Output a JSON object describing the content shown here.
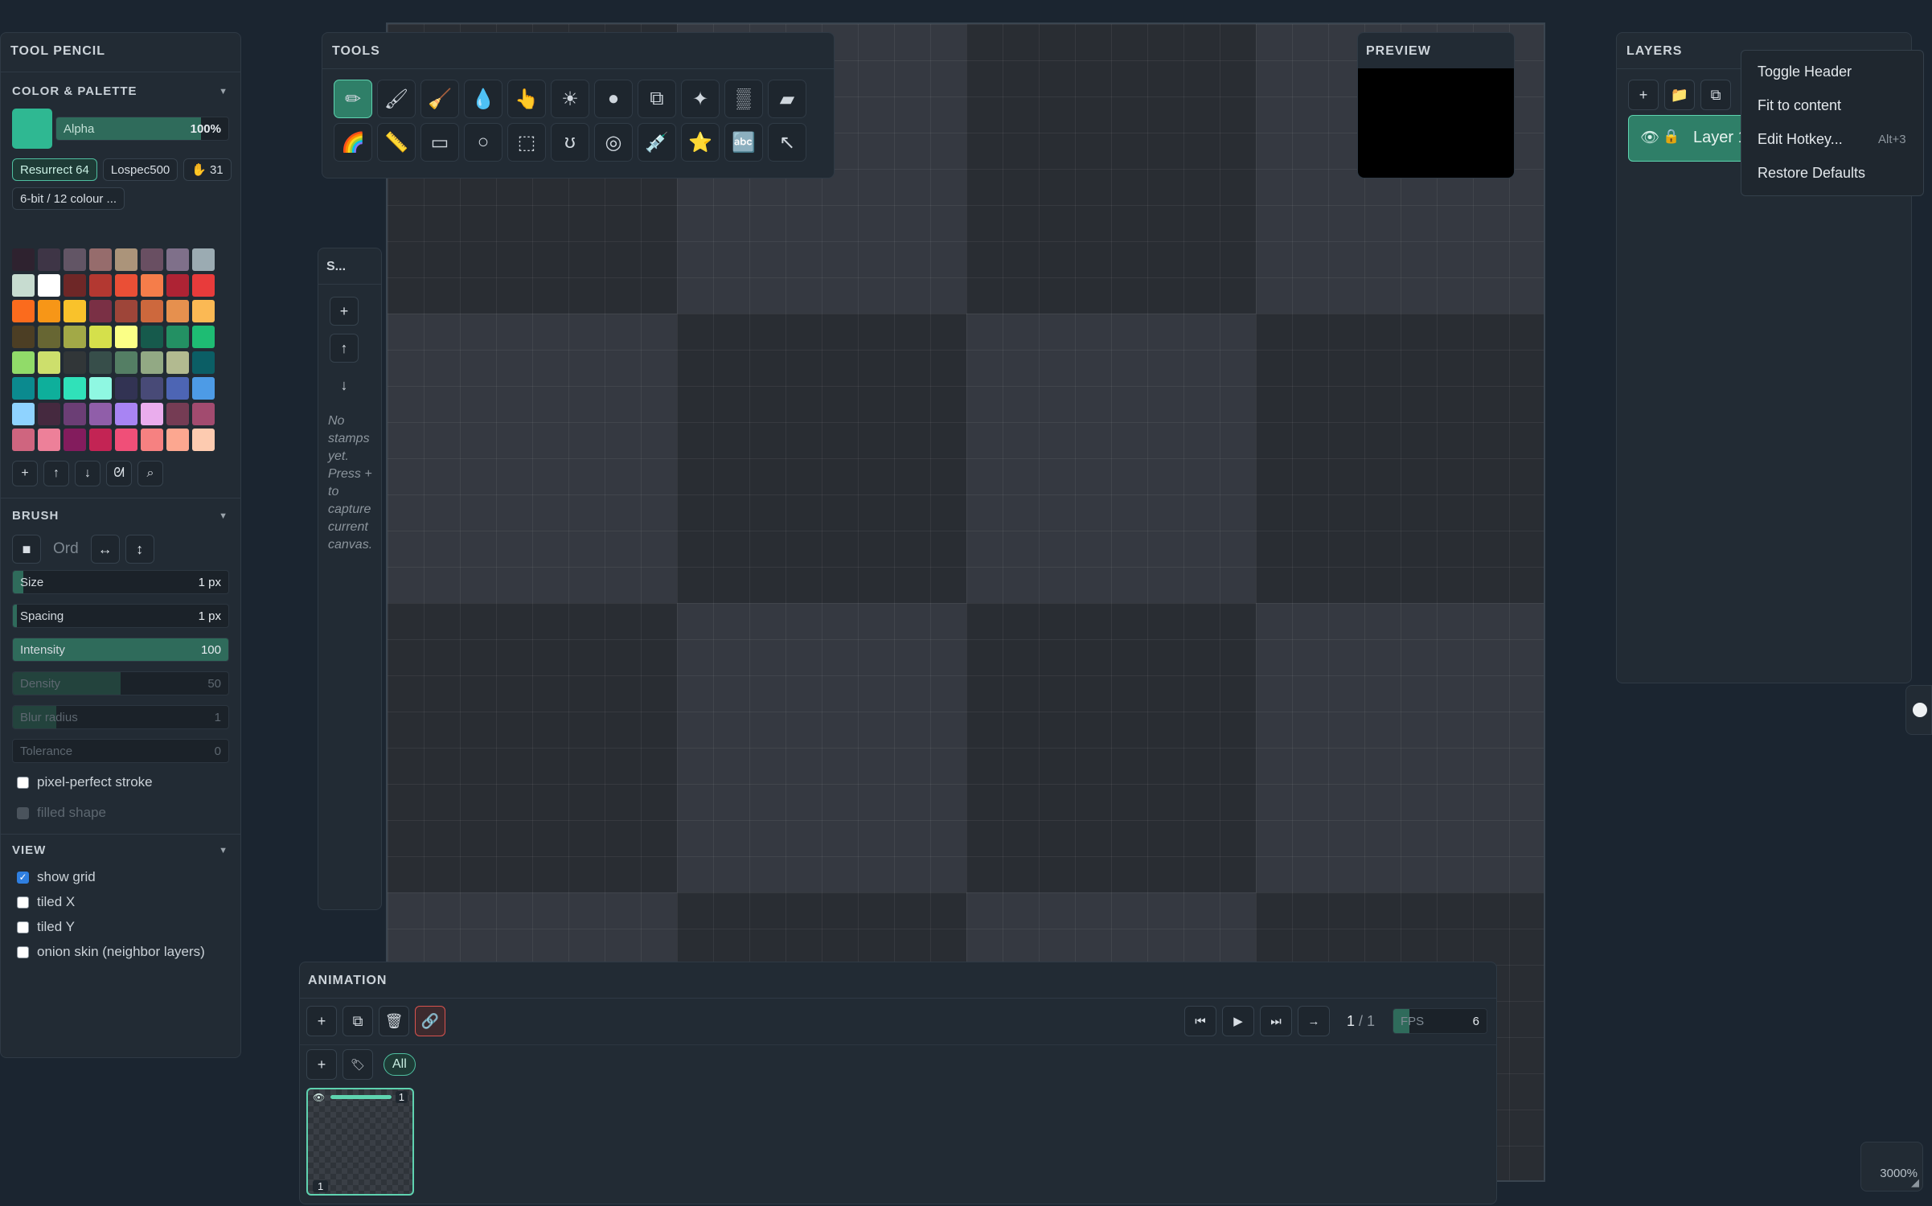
{
  "canvas": {
    "zoom": "3000%"
  },
  "left_panel": {
    "title": "TOOL PENCIL",
    "color_section": {
      "title": "COLOR & PALETTE",
      "current_color": "#2fb892",
      "alpha_label": "Alpha",
      "alpha_value": "100%",
      "alpha_fraction": 0.84,
      "palette_tabs": [
        "Resurrect 64",
        "Lospec500"
      ],
      "palette_count": "31",
      "palette_filter": "6-bit / 12 colour ...",
      "swatches": [
        "#2e222f",
        "#3e3546",
        "#625565",
        "#966c6c",
        "#ab947a",
        "#694f62",
        "#7f708a",
        "#9babb2",
        "#c7dcd0",
        "#ffffff",
        "#6e2727",
        "#b33831",
        "#ea4f36",
        "#f57d4a",
        "#ae2334",
        "#e83b3b",
        "#fb6b1d",
        "#f79617",
        "#f9c22b",
        "#7a3045",
        "#9e4539",
        "#cd683d",
        "#e6904e",
        "#fbb954",
        "#4c3e24",
        "#676633",
        "#a2a947",
        "#d5e04b",
        "#fbff86",
        "#165a4c",
        "#239063",
        "#1ebc73",
        "#91db69",
        "#cddf6c",
        "#313638",
        "#374e4a",
        "#547e64",
        "#92a984",
        "#b2ba90",
        "#0b5e65",
        "#0b8a8f",
        "#0eaf9b",
        "#30e1b9",
        "#8ff8e2",
        "#323353",
        "#484a77",
        "#4d65b4",
        "#4d9be6",
        "#8fd3ff",
        "#45293f",
        "#6b3e75",
        "#905ea9",
        "#a884f3",
        "#eaaded",
        "#753c54",
        "#a24b6f",
        "#cf657f",
        "#ed8099",
        "#831c5d",
        "#c32454",
        "#f04f78",
        "#f68181",
        "#fca790",
        "#fdcbb0"
      ],
      "palette_buttons": [
        "+",
        "↑",
        "↓",
        "ᘛ",
        "⌕"
      ]
    },
    "brush": {
      "title": "BRUSH",
      "order_label": "Ord",
      "mode_buttons": [
        "■",
        "↔",
        "↕"
      ],
      "sliders": [
        {
          "label": "Size",
          "value": "1 px",
          "fraction": 0.05,
          "dim": false
        },
        {
          "label": "Spacing",
          "value": "1 px",
          "fraction": 0.02,
          "dim": false
        },
        {
          "label": "Intensity",
          "value": "100",
          "fraction": 1.0,
          "dim": false
        },
        {
          "label": "Density",
          "value": "50",
          "fraction": 0.5,
          "dim": true
        },
        {
          "label": "Blur radius",
          "value": "1",
          "fraction": 0.2,
          "dim": true
        },
        {
          "label": "Tolerance",
          "value": "0",
          "fraction": 0.0,
          "dim": true
        }
      ],
      "pixel_perfect": "pixel-perfect stroke",
      "filled_shape": "filled shape"
    },
    "view": {
      "title": "VIEW",
      "show_grid": "show grid",
      "tiled_x": "tiled X",
      "tiled_y": "tiled Y",
      "onion_skin": "onion skin (neighbor layers)"
    }
  },
  "tools_panel": {
    "title": "TOOLS",
    "row1_icons": [
      "pencil-icon",
      "brush-icon",
      "broom-icon",
      "drop-icon",
      "pointer-icon",
      "sun-icon",
      "sphere-icon",
      "copy-icon",
      "sparkle-icon",
      "dither-icon",
      "eraser-icon"
    ],
    "row2_icons": [
      "rainbow-icon",
      "ruler-icon",
      "rectangle-icon",
      "ellipse-icon",
      "selection-icon",
      "lasso-icon",
      "spiral-icon",
      "syringe-icon",
      "star-icon",
      "text-icon",
      "arrow-icon"
    ],
    "row1_glyphs": [
      "✏",
      "🖌",
      "🧹",
      "💧",
      "👆",
      "☀",
      "●",
      "⧉",
      "✦",
      "▒",
      "▰"
    ],
    "row2_glyphs": [
      "🌈",
      "📏",
      "▭",
      "○",
      "⬚",
      "ʊ",
      "◎",
      "💉",
      "⭐",
      "🔤",
      "↖"
    ]
  },
  "stamps_panel": {
    "title": "S...",
    "buttons": [
      "+",
      "↑",
      "↓"
    ],
    "empty_text": "No stamps yet. Press + to capture current canvas."
  },
  "preview_panel": {
    "title": "PREVIEW"
  },
  "layers_panel": {
    "title": "LAYERS",
    "layer_name": "Layer 1",
    "buttons": [
      "+",
      "📁",
      "⧉"
    ]
  },
  "context_menu": {
    "items": [
      {
        "label": "Toggle Header",
        "hotkey": ""
      },
      {
        "label": "Fit to content",
        "hotkey": ""
      },
      {
        "label": "Edit Hotkey...",
        "hotkey": "Alt+3"
      },
      {
        "label": "Restore Defaults",
        "hotkey": ""
      }
    ]
  },
  "animation_panel": {
    "title": "ANIMATION",
    "frame_position": "1",
    "frame_total": "/ 1",
    "fps_label": "FPS",
    "fps_value": "6",
    "tag_all": "All",
    "frame_number": "1",
    "frame_index": "1",
    "frame_buttons": [
      "+",
      "⧉",
      "🗑",
      "🔗"
    ],
    "tag_buttons": [
      "+",
      "🏷"
    ],
    "playback": [
      "⏮",
      "▶",
      "⏭",
      "→"
    ]
  },
  "colors": {
    "accent": "#2f7f68",
    "accent_light": "#5fd3b0"
  }
}
